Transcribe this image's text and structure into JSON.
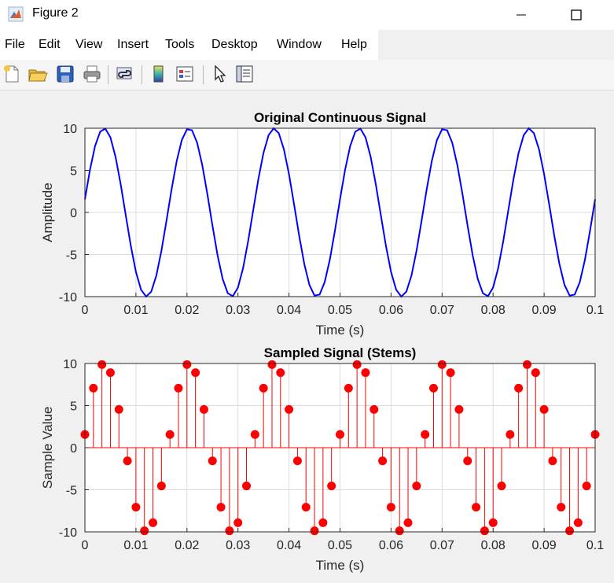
{
  "window": {
    "title": "Figure 2"
  },
  "menu": [
    "File",
    "Edit",
    "View",
    "Insert",
    "Tools",
    "Desktop",
    "Window",
    "Help"
  ],
  "toolbar_icons": [
    "new-figure-icon",
    "open-file-icon",
    "save-icon",
    "print-icon",
    "link-plot-icon",
    "colorbar-icon",
    "legend-icon",
    "select-arrow-icon",
    "property-inspector-icon"
  ],
  "colors": {
    "line": "#0000ff",
    "stem": "#ff0000",
    "grid": "#dcdcdc"
  },
  "chart_data": [
    {
      "type": "line",
      "title": "Original Continuous Signal",
      "xlabel": "Time (s)",
      "ylabel": "Amplitude",
      "xlim": [
        0,
        0.1
      ],
      "ylim": [
        -10,
        10
      ],
      "x_ticks": [
        "0",
        "0.01",
        "0.02",
        "0.03",
        "0.04",
        "0.05",
        "0.06",
        "0.07",
        "0.08",
        "0.09",
        "0.1"
      ],
      "y_ticks": [
        "10",
        "5",
        "0",
        "-5",
        "-10"
      ],
      "grid": true,
      "series": [
        {
          "function": "10*sin(2*pi*60*t + 0.157)",
          "t_start": 0,
          "t_end": 0.1,
          "points": 101
        }
      ]
    },
    {
      "type": "stem",
      "title": "Sampled Signal (Stems)",
      "xlabel": "Time (s)",
      "ylabel": "Sample Value",
      "xlim": [
        0,
        0.1
      ],
      "ylim": [
        -10,
        10
      ],
      "x_ticks": [
        "0",
        "0.01",
        "0.02",
        "0.03",
        "0.04",
        "0.05",
        "0.06",
        "0.07",
        "0.08",
        "0.09",
        "0.1"
      ],
      "y_ticks": [
        "10",
        "5",
        "0",
        "-5",
        "-10"
      ],
      "grid": true,
      "series": [
        {
          "function": "10*sin(2*pi*60*t + 0.157)",
          "t_start": 0,
          "t_end": 0.1,
          "points": 61
        }
      ]
    }
  ]
}
